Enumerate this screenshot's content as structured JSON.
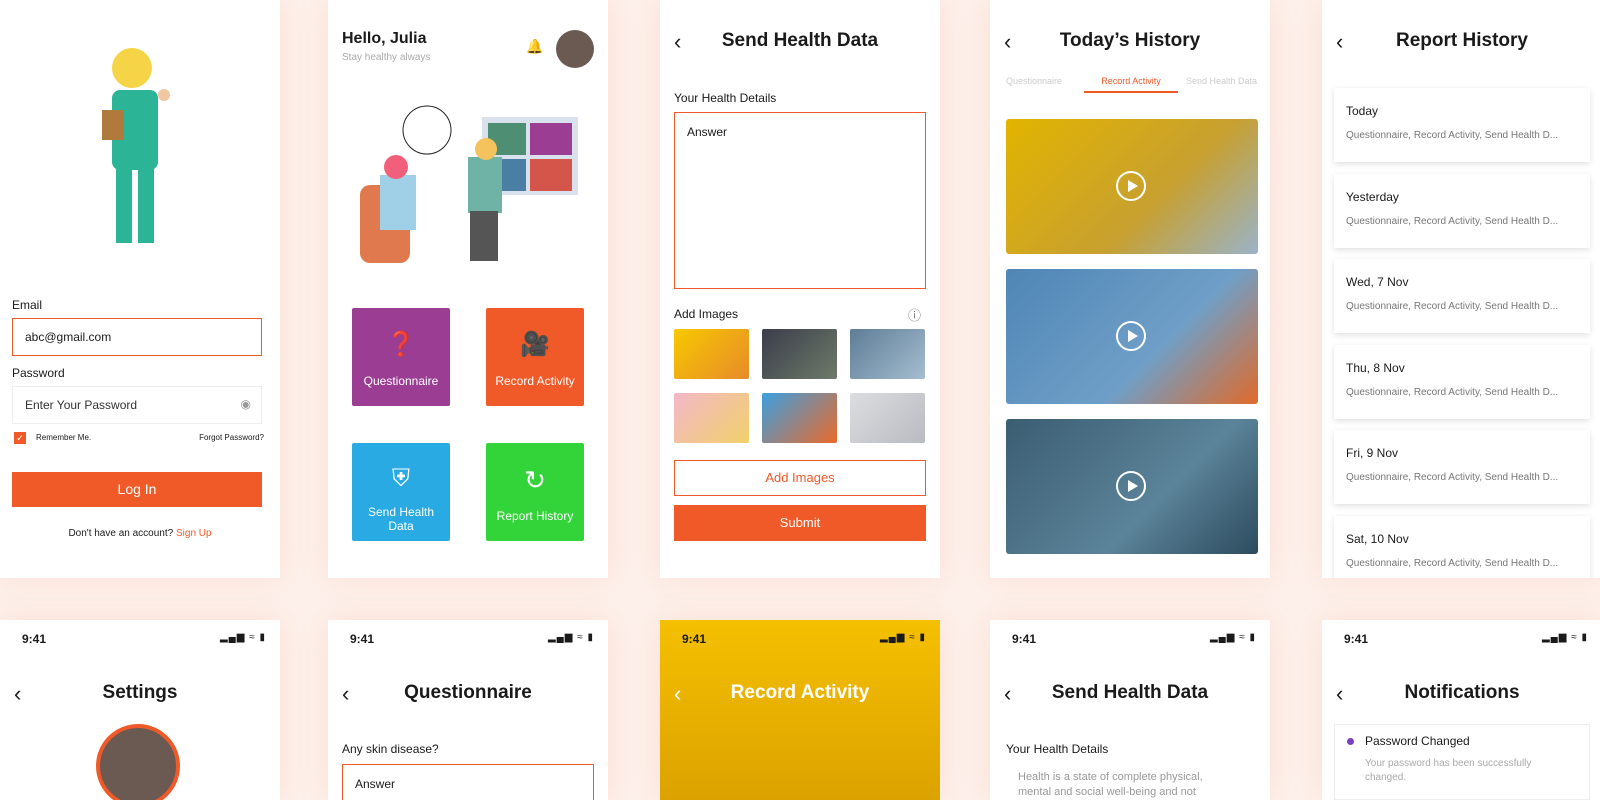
{
  "login": {
    "email_label": "Email",
    "email_value": "abc@gmail.com",
    "password_label": "Password",
    "password_placeholder": "Enter Your Password",
    "remember": "Remember Me.",
    "forgot": "Forgot Password?",
    "login_button": "Log In",
    "signup_prompt": "Don't have an account?",
    "signup_link": "Sign Up"
  },
  "home": {
    "greeting": "Hello, Julia",
    "subtitle": "Stay healthy always",
    "tiles": [
      {
        "label": "Questionnaire",
        "color": "#9b3e93"
      },
      {
        "label": "Record Activity",
        "color": "#f05a28"
      },
      {
        "label": "Send Health Data",
        "color": "#29aae2"
      },
      {
        "label": "Report History",
        "color": "#33d43a"
      }
    ]
  },
  "send": {
    "title": "Send Health Data",
    "details_label": "Your Health Details",
    "answer_placeholder": "Answer",
    "add_images_label": "Add Images",
    "add_images_button": "Add Images",
    "submit": "Submit"
  },
  "history": {
    "title": "Today’s History",
    "tabs": [
      "Questionnaire",
      "Record Activity",
      "Send Health Data"
    ],
    "active_tab": "Record Activity"
  },
  "report": {
    "title": "Report History",
    "items": [
      {
        "date": "Today",
        "summary": "Questionnaire, Record Activity, Send Health D..."
      },
      {
        "date": "Yesterday",
        "summary": "Questionnaire, Record Activity, Send Health D..."
      },
      {
        "date": "Wed, 7 Nov",
        "summary": "Questionnaire, Record Activity, Send Health D..."
      },
      {
        "date": "Thu, 8 Nov",
        "summary": "Questionnaire, Record Activity, Send Health D..."
      },
      {
        "date": "Fri, 9 Nov",
        "summary": "Questionnaire, Record Activity, Send Health D..."
      },
      {
        "date": "Sat, 10 Nov",
        "summary": "Questionnaire, Record Activity, Send Health D..."
      }
    ]
  },
  "status_time": "9:41",
  "settings": {
    "title": "Settings"
  },
  "questionnaire": {
    "title": "Questionnaire",
    "question": "Any skin disease?",
    "answer_placeholder": "Answer"
  },
  "record": {
    "title": "Record Activity"
  },
  "send2": {
    "title": "Send Health Data",
    "details_label": "Your Health Details",
    "body": "Health is a state of complete physical, mental and social well-being and not"
  },
  "notifications": {
    "title": "Notifications",
    "item_title": "Password Changed",
    "item_body": "Your password has been successfully changed."
  },
  "colors": {
    "accent": "#f05a28",
    "yellow": "#f3b800"
  }
}
